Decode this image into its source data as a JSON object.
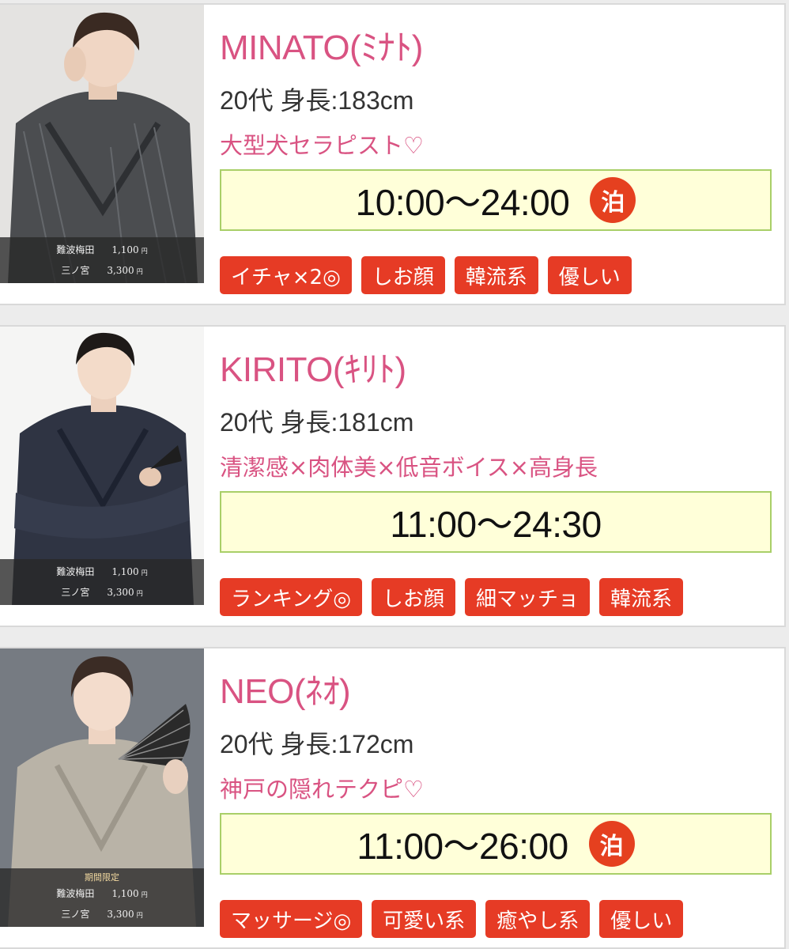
{
  "staff": [
    {
      "name": "MINATO(ﾐﾅﾄ)",
      "profile": "20代 身長:183cm",
      "catch": "大型犬セラピスト♡",
      "schedule": "10:00〜24:00",
      "stay_badge": "泊",
      "limited_label": "",
      "prices": [
        {
          "area": "難波梅田",
          "amount": "1,100",
          "unit": "円"
        },
        {
          "area": "三ノ宮",
          "amount": "3,300",
          "unit": "円"
        }
      ],
      "tags": [
        "イチャ×2◎",
        "しお顔",
        "韓流系",
        "優しい"
      ]
    },
    {
      "name": "KIRITO(ｷﾘﾄ)",
      "profile": "20代 身長:181cm",
      "catch": "清潔感×肉体美×低音ボイス×高身長",
      "schedule": "11:00〜24:30",
      "stay_badge": "",
      "limited_label": "",
      "prices": [
        {
          "area": "難波梅田",
          "amount": "1,100",
          "unit": "円"
        },
        {
          "area": "三ノ宮",
          "amount": "3,300",
          "unit": "円"
        }
      ],
      "tags": [
        "ランキング◎",
        "しお顔",
        "細マッチョ",
        "韓流系"
      ]
    },
    {
      "name": "NEO(ﾈｵ)",
      "profile": "20代 身長:172cm",
      "catch": "神戸の隠れテクピ♡",
      "schedule": "11:00〜26:00",
      "stay_badge": "泊",
      "limited_label": "期間限定",
      "prices": [
        {
          "area": "難波梅田",
          "amount": "1,100",
          "unit": "円"
        },
        {
          "area": "三ノ宮",
          "amount": "3,300",
          "unit": "円"
        }
      ],
      "tags": [
        "マッサージ◎",
        "可愛い系",
        "癒やし系",
        "優しい"
      ]
    }
  ],
  "colors": {
    "name_pink": "#d95382",
    "tag_red": "#e63b25",
    "schedule_bg": "#ffffd9",
    "schedule_border": "#a9cf68",
    "badge_red": "#e5401f"
  },
  "icons": {
    "photo": "therapist-photo"
  }
}
